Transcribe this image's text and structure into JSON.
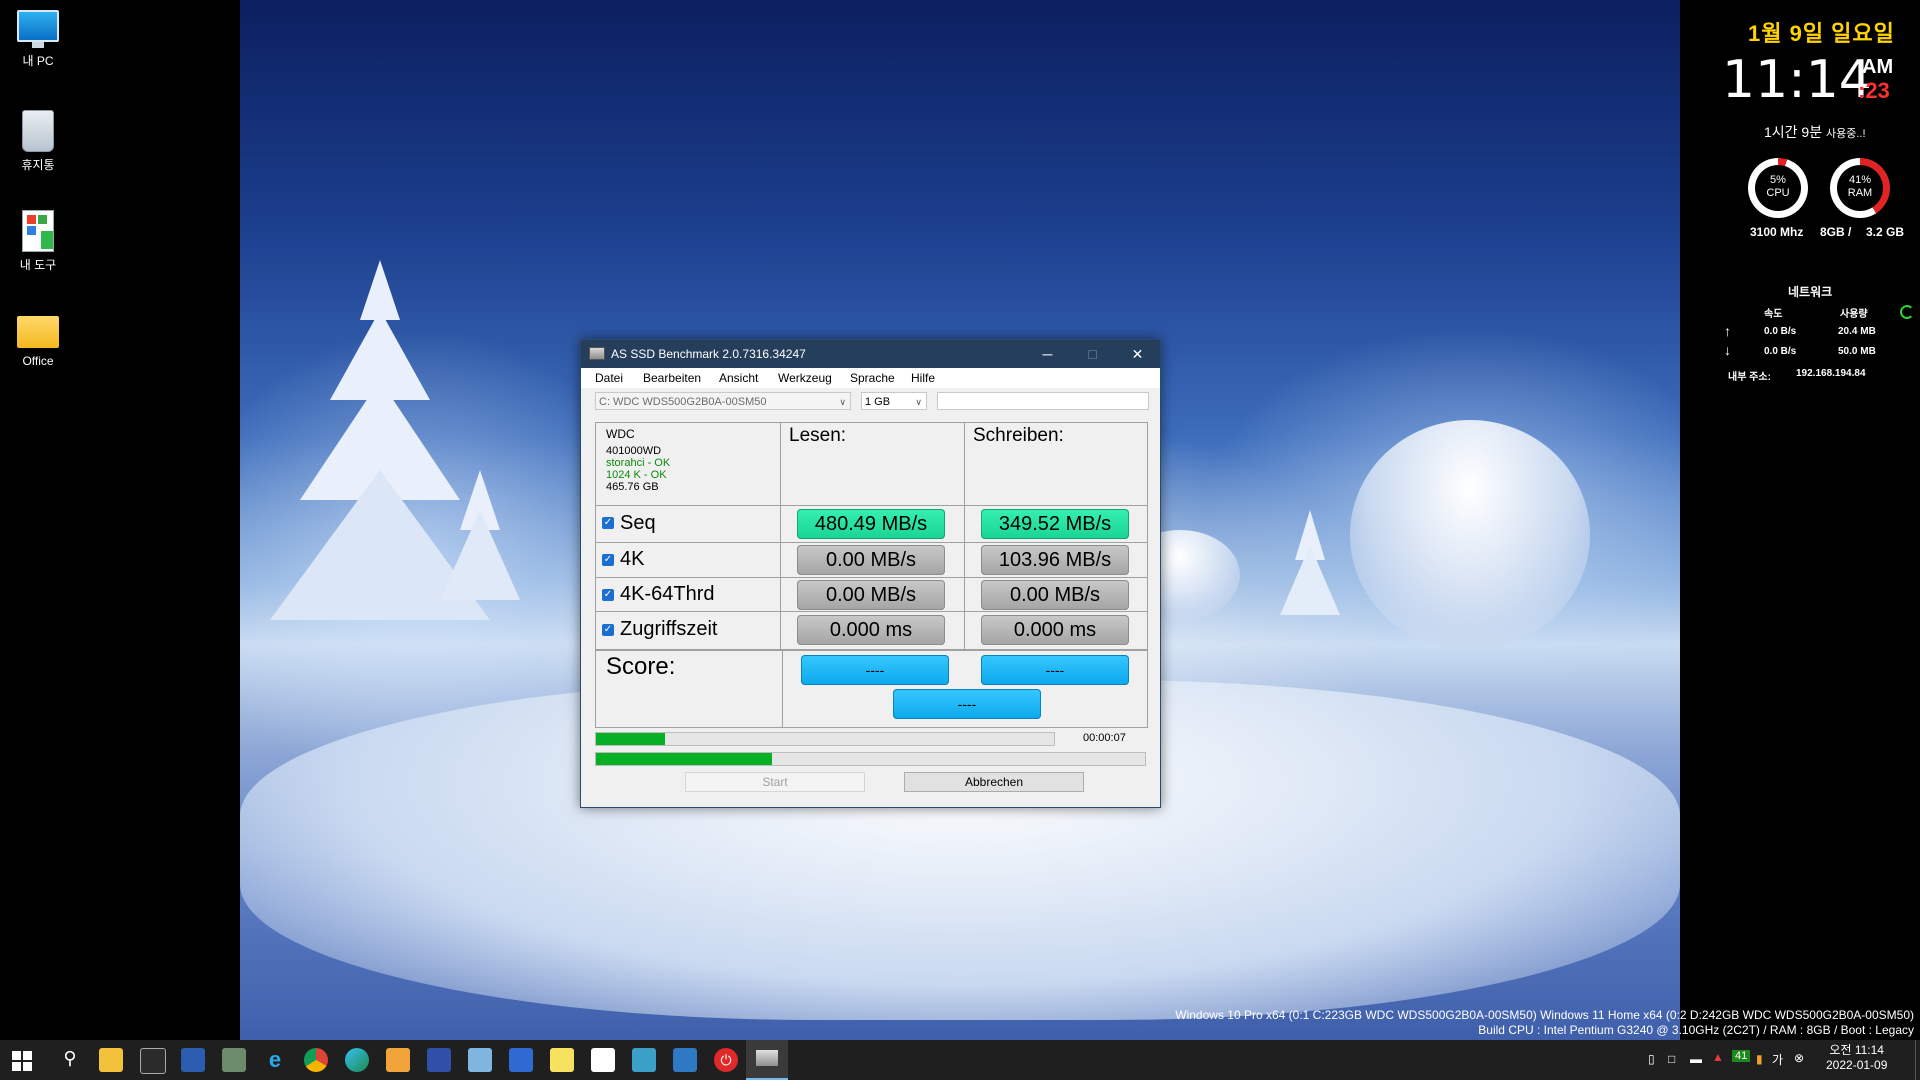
{
  "desktop": {
    "icons": [
      {
        "label": "내 PC",
        "icon": "computer-icon"
      },
      {
        "label": "휴지통",
        "icon": "recycle-bin-icon"
      },
      {
        "label": "내 도구",
        "icon": "tools-icon"
      },
      {
        "label": "Office",
        "icon": "folder-icon"
      }
    ]
  },
  "widget": {
    "date": "1월 9일 일요일",
    "time": "11:14",
    "ampm": "AM",
    "seconds": ":23",
    "uptime_main": "1시간 9분",
    "uptime_suffix": "사용중..!",
    "cpu": {
      "percent_label": "5%",
      "label": "CPU",
      "value": 5,
      "freq": "3100 Mhz"
    },
    "ram": {
      "percent_label": "41%",
      "label": "RAM",
      "value": 41,
      "total": "8GB /",
      "used": "3.2 GB"
    },
    "network": {
      "title": "네트워크",
      "col_speed": "속도",
      "col_usage": "사용량",
      "up_speed": "0.0 B/s",
      "up_usage": "20.4 MB",
      "down_speed": "0.0 B/s",
      "down_usage": "50.0 MB",
      "ip_label": "내부 주소:",
      "ip": "192.168.194.84"
    }
  },
  "window": {
    "title": "AS SSD Benchmark 2.0.7316.34247",
    "menu": [
      "Datei",
      "Bearbeiten",
      "Ansicht",
      "Werkzeug",
      "Sprache",
      "Hilfe"
    ],
    "drive_select": "C: WDC  WDS500G2B0A-00SM50",
    "size_select": "1 GB",
    "drive_info": {
      "vendor": "WDC",
      "firmware": "401000WD",
      "driver": "storahci - OK",
      "alignment": "1024 K - OK",
      "capacity": "465.76 GB"
    },
    "col_read": "Lesen:",
    "col_write": "Schreiben:",
    "rows": [
      {
        "label": "Seq",
        "read": "480.49 MB/s",
        "write": "349.52 MB/s"
      },
      {
        "label": "4K",
        "read": "0.00 MB/s",
        "write": "103.96 MB/s"
      },
      {
        "label": "4K-64Thrd",
        "read": "0.00 MB/s",
        "write": "0.00 MB/s"
      },
      {
        "label": "Zugriffszeit",
        "read": "0.000 ms",
        "write": "0.000 ms"
      }
    ],
    "score_label": "Score:",
    "score_read": "----",
    "score_write": "----",
    "score_total": "----",
    "progress_top": 0.15,
    "progress_bottom": 0.32,
    "elapsed": "00:00:07",
    "start_label": "Start",
    "cancel_label": "Abbrechen"
  },
  "sysinfo": {
    "line1": "Windows 10 Pro x64 (0:1 C:223GB WDC  WDS500G2B0A-00SM50) Windows 11 Home x64 (0:2 D:242GB WDC  WDS500G2B0A-00SM50)",
    "line2": "Build CPU : Intel Pentium G3240 @ 3.10GHz (2C2T) / RAM : 8GB / Boot : Legacy"
  },
  "taskbar": {
    "clock_time": "오전 11:14",
    "clock_date": "2022-01-09",
    "tray_badge": "41",
    "tray_lang": "가"
  },
  "colors": {
    "green_result": "#1fdc9c",
    "gray_result": "#b4b4b4",
    "score_blue": "#0ba8ec",
    "progress_green": "#06b025",
    "date_yellow": "#ffd200",
    "seconds_red": "#ff3030"
  }
}
